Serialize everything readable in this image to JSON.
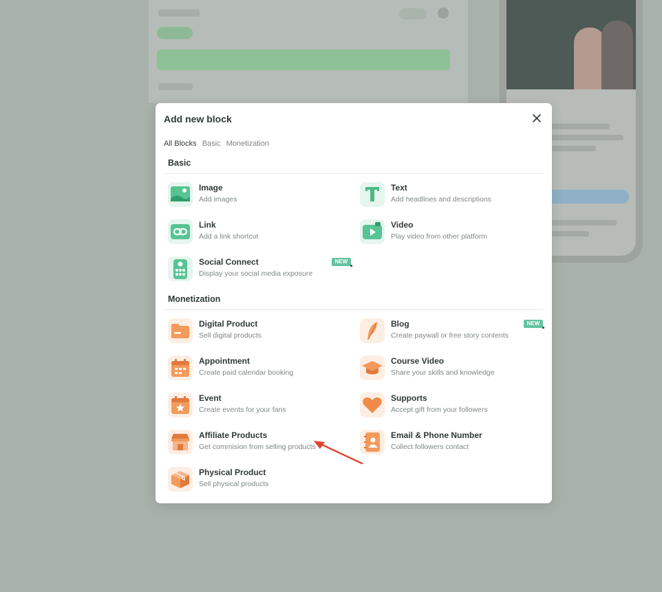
{
  "modal": {
    "title": "Add new block",
    "tabs": [
      {
        "label": "All Blocks",
        "active": true
      },
      {
        "label": "Basic",
        "active": false
      },
      {
        "label": "Monetization",
        "active": false
      }
    ]
  },
  "sections": {
    "basic": {
      "title": "Basic",
      "items": [
        {
          "name": "Image",
          "desc": "Add images",
          "icon": "image-icon"
        },
        {
          "name": "Text",
          "desc": "Add headlines and descriptions",
          "icon": "text-icon"
        },
        {
          "name": "Link",
          "desc": "Add a link shortcut",
          "icon": "link-icon"
        },
        {
          "name": "Video",
          "desc": "Play video from other platform",
          "icon": "video-icon"
        },
        {
          "name": "Social Connect",
          "desc": "Display your social media exposure",
          "icon": "social-connect-icon",
          "badge": "NEW"
        }
      ]
    },
    "monetization": {
      "title": "Monetization",
      "items": [
        {
          "name": "Digital Product",
          "desc": "Sell digital products",
          "icon": "folder-icon"
        },
        {
          "name": "Blog",
          "desc": "Create paywall or free story contents",
          "icon": "feather-icon",
          "badge": "NEW"
        },
        {
          "name": "Appointment",
          "desc": "Create paid calendar booking",
          "icon": "calendar-icon"
        },
        {
          "name": "Course Video",
          "desc": "Share your skills and knowledge",
          "icon": "graduation-cap-icon"
        },
        {
          "name": "Event",
          "desc": "Create events for your fans",
          "icon": "event-star-icon"
        },
        {
          "name": "Supports",
          "desc": "Accept gift from your followers",
          "icon": "heart-icon"
        },
        {
          "name": "Affiliate Products",
          "desc": "Get commision from selling products",
          "icon": "storefront-icon"
        },
        {
          "name": "Email & Phone Number",
          "desc": "Collect followers contact",
          "icon": "contact-book-icon"
        },
        {
          "name": "Physical Product",
          "desc": "Sell physical products",
          "icon": "box-icon"
        }
      ]
    }
  },
  "colors": {
    "basic_accent": "#4fbf8b",
    "monetization_accent": "#f08a4b",
    "badge": "#63c3a0",
    "annotation_arrow": "#e0452f"
  }
}
